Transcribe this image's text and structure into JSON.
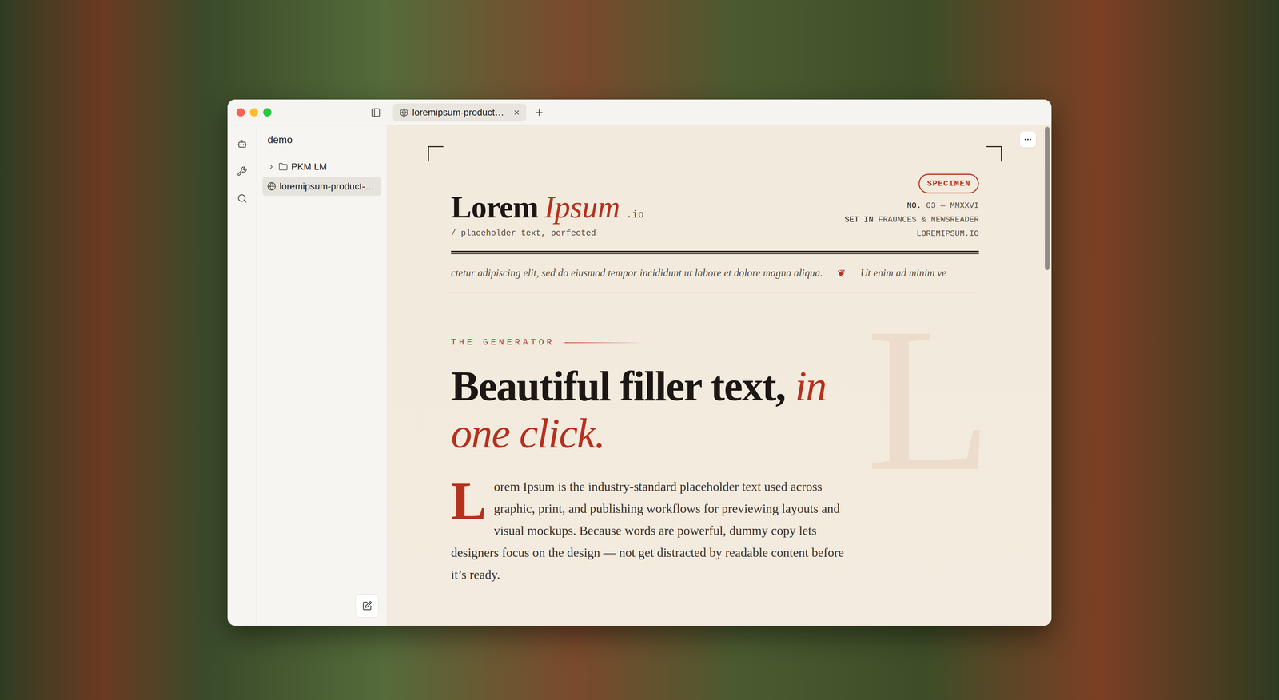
{
  "tabs": [
    {
      "label": "loremipsum-product…",
      "close": "×",
      "selected": true
    }
  ],
  "new_tab": "+",
  "sidebar": {
    "workspace": "demo",
    "items": [
      {
        "label": "PKM LM",
        "kind": "folder",
        "expanded": false,
        "selected": false
      },
      {
        "label": "loremipsum-product-…",
        "kind": "page",
        "selected": true
      }
    ]
  },
  "page": {
    "badge": "SPECIMEN",
    "logo": {
      "word": "Lorem",
      "accent": "Ipsum",
      "suffix": ".io"
    },
    "tagline": "/ placeholder text, perfected",
    "meta": [
      {
        "label": "NO.",
        "value": "03 — MMXXVI"
      },
      {
        "label": "SET IN",
        "value": "FRAUNCES & NEWSREADER"
      },
      {
        "label": "",
        "value": "LOREMIPSUM.IO"
      }
    ],
    "marquee": {
      "segments": [
        "ctetur adipiscing elit, sed do eiusmod tempor incididunt ut labore et dolore magna aliqua.",
        "Ut enim ad minim ve"
      ],
      "separator": "❦"
    },
    "eyebrow": "THE GENERATOR",
    "heading": "Beautiful filler text,",
    "heading_accent": "in one click.",
    "dropcap": "L",
    "body": "orem Ipsum is the industry-standard placeholder text used across graphic, print, and publishing workflows for previewing layouts and visual mockups. Because words are powerful, dummy copy lets designers focus on the design — not get distracted by readable content before it’s ready.",
    "watermark": "L"
  }
}
